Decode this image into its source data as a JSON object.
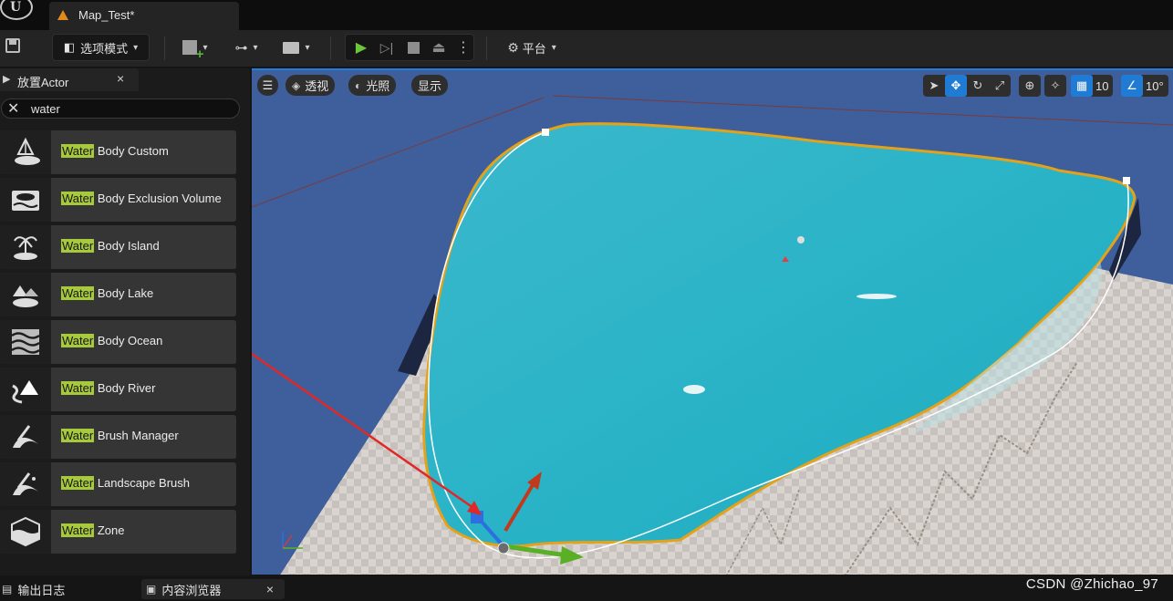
{
  "titlebar": {
    "logo_glyph": "U",
    "document_tab": "Map_Test*"
  },
  "toolbar": {
    "mode_label": "选项模式",
    "platform_label": "平台",
    "icons": [
      "save-icon",
      "select-mode-icon",
      "add-actor-icon",
      "blueprint-icon",
      "cinematics-icon",
      "play-icon",
      "step-icon",
      "stop-icon",
      "eject-icon",
      "more-icon",
      "platform-icon"
    ]
  },
  "left_panel": {
    "tab_label": "放置Actor",
    "close_glyph": "×",
    "search_value": "water",
    "items": [
      {
        "highlight": "Water",
        "rest": " Body Custom",
        "icon": "water-body-custom-icon"
      },
      {
        "highlight": "Water",
        "rest": " Body Exclusion Volume",
        "icon": "water-body-exclusion-icon"
      },
      {
        "highlight": "Water",
        "rest": " Body Island",
        "icon": "island-icon"
      },
      {
        "highlight": "Water",
        "rest": " Body Lake",
        "icon": "lake-icon"
      },
      {
        "highlight": "Water",
        "rest": " Body Ocean",
        "icon": "ocean-icon"
      },
      {
        "highlight": "Water",
        "rest": " Body River",
        "icon": "river-icon"
      },
      {
        "highlight": "Water",
        "rest": " Brush Manager",
        "icon": "brush-manager-icon"
      },
      {
        "highlight": "Water",
        "rest": " Landscape Brush",
        "icon": "landscape-brush-icon"
      },
      {
        "highlight": "Water",
        "rest": " Zone",
        "icon": "water-zone-icon"
      }
    ]
  },
  "viewport": {
    "perspective_label": "透视",
    "lit_label": "光照",
    "show_label": "显示",
    "grid_snap_value": "10",
    "rotation_snap_value": "10°",
    "colors": {
      "sky": "#3f5f9c",
      "water": "#2cb6c9",
      "spline": "#e3a21a",
      "selection_border": "#1f80d6",
      "arrow": "#e02828"
    }
  },
  "bottombar": {
    "output_log": "输出日志",
    "content_browser": "内容浏览器",
    "watermark": "CSDN @Zhichao_97"
  }
}
